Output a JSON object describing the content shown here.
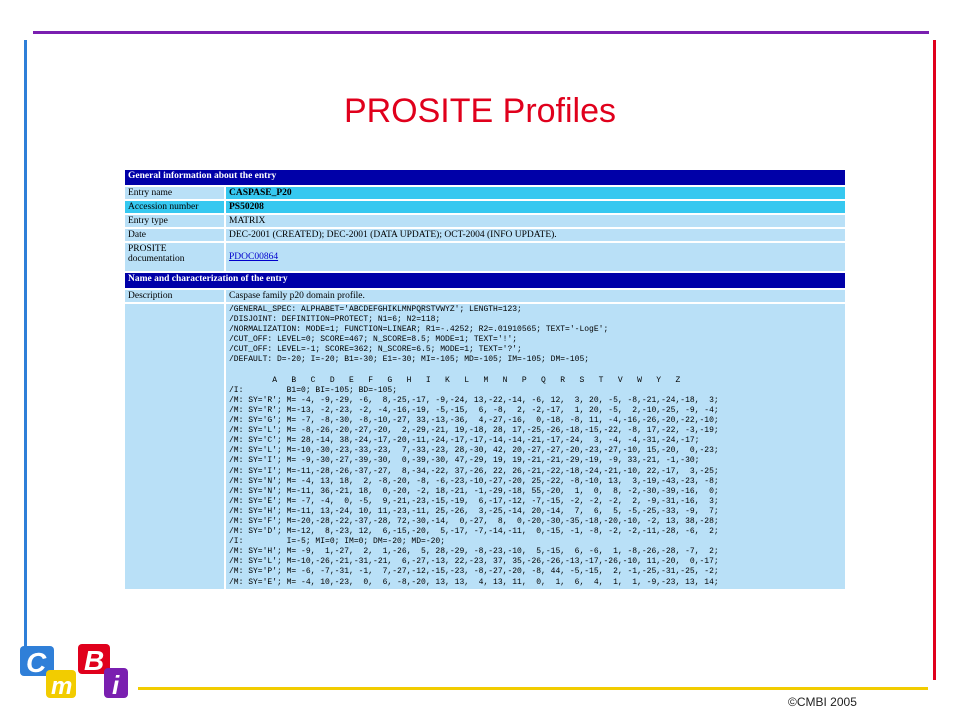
{
  "slide": {
    "title": "PROSITE Profiles",
    "copyright": "©CMBI 2005"
  },
  "logo": {
    "letters": [
      "C",
      "m",
      "B",
      "i"
    ],
    "text": "CMBI"
  },
  "entry": {
    "section_general": "General information about the entry",
    "rows": [
      {
        "label": "Entry name",
        "value": "CASPASE_P20"
      },
      {
        "label": "Accession number",
        "value": "PS50208"
      },
      {
        "label": "Entry type",
        "value": "MATRIX"
      },
      {
        "label": "Date",
        "value": "DEC-2001 (CREATED); DEC-2001 (DATA UPDATE); OCT-2004 (INFO UPDATE)."
      },
      {
        "label": "PROSITE documentation",
        "value": "PDOC00864"
      }
    ],
    "section_name": "Name and characterization of the entry",
    "description_label": "Description",
    "description_value": "Caspase family p20 domain profile.",
    "profile_lines": [
      "/GENERAL_SPEC: ALPHABET='ABCDEFGHIKLMNPQRSTVWYZ'; LENGTH=123;",
      "/DISJOINT: DEFINITION=PROTECT; N1=6; N2=118;",
      "/NORMALIZATION: MODE=1; FUNCTION=LINEAR; R1=-.4252; R2=.01910565; TEXT='-LogE';",
      "/CUT_OFF: LEVEL=0; SCORE=467; N_SCORE=8.5; MODE=1; TEXT='!';",
      "/CUT_OFF: LEVEL=-1; SCORE=362; N_SCORE=6.5; MODE=1; TEXT='?';",
      "/DEFAULT: D=-20; I=-20; B1=-30; E1=-30; MI=-105; MD=-105; IM=-105; DM=-105;",
      "",
      "         A   B   C   D   E   F   G   H   I   K   L   M   N   P   Q   R   S   T   V   W   Y   Z",
      "/I:         B1=0; BI=-105; BD=-105;",
      "/M: SY='R'; M= -4, -9,-29, -6,  8,-25,-17, -9,-24, 13,-22,-14, -6, 12,  3, 20, -5, -8,-21,-24,-18,  3;",
      "/M: SY='R'; M=-13, -2,-23, -2, -4,-16,-19, -5,-15,  6, -8,  2, -2,-17,  1, 20, -5,  2,-10,-25, -9, -4;",
      "/M: SY='G'; M= -7, -8,-30, -8,-10,-27, 33,-13,-36,  4,-27,-16,  0,-18, -8, 11, -4,-16,-26,-20,-22,-10;",
      "/M: SY='L'; M= -8,-26,-20,-27,-20,  2,-29,-21, 19,-18, 28, 17,-25,-26,-18,-15,-22, -8, 17,-22, -3,-19;",
      "/M: SY='C'; M= 28,-14, 38,-24,-17,-20,-11,-24,-17,-17,-14,-14,-21,-17,-24,  3, -4, -4,-31,-24,-17;",
      "/M: SY='L'; M=-10,-30,-23,-33,-23,  7,-33,-23, 28,-30, 42, 20,-27,-27,-20,-23,-27,-10, 15,-20,  0,-23;",
      "/M: SY='I'; M= -9,-30,-27,-39,-30,  0,-39,-30, 47,-29, 19, 19,-21,-21,-29,-19, -9, 33,-21, -1,-30;",
      "/M: SY='I'; M=-11,-28,-26,-37,-27,  8,-34,-22, 37,-26, 22, 26,-21,-22,-18,-24,-21,-10, 22,-17,  3,-25;",
      "/M: SY='N'; M= -4, 13, 18,  2, -8,-20, -8, -6,-23,-10,-27,-20, 25,-22, -8,-10, 13,  3,-19,-43,-23, -8;",
      "/M: SY='N'; M=-11, 36,-21, 18,  0,-20, -2, 18,-21, -1,-29,-18, 55,-20,  1,  0,  8, -2,-30,-39,-16,  0;",
      "/M: SY='E'; M= -7, -4,  0, -5,  9,-21,-23,-15,-19,  6,-17,-12, -7,-15, -2, -2, -2,  2, -9,-31,-16,  3;",
      "/M: SY='H'; M=-11, 13,-24, 10, 11,-23,-11, 25,-26,  3,-25,-14, 20,-14,  7,  6,  5, -5,-25,-33, -9,  7;",
      "/M: SY='F'; M=-20,-28,-22,-37,-28, 72,-30,-14,  0,-27,  8,  0,-20,-30,-35,-18,-20,-10, -2, 13, 38,-28;",
      "/M: SY='D'; M=-12,  8,-23, 12,  6,-15,-20,  5,-17, -7,-14,-11,  0,-15, -1, -8, -2, -2,-11,-28, -6,  2;",
      "/I:         I=-5; MI=0; IM=0; DM=-20; MD=-20;",
      "/M: SY='H'; M= -9,  1,-27,  2,  1,-26,  5, 28,-29, -8,-23,-10,  5,-15,  6, -6,  1, -8,-26,-28, -7,  2;",
      "/M: SY='L'; M=-10,-26,-21,-31,-21,  6,-27,-13, 22,-23, 37, 35,-26,-26,-13,-17,-26,-10, 11,-20,  0,-17;",
      "/M: SY='P'; M= -6, -7,-31, -1,  7,-27,-12,-15,-23, -8,-27,-20, -8, 44, -5,-15,  2, -1,-25,-31,-25, -2;",
      "/M: SY='E'; M= -4, 10,-23,  0,  6, -8,-20, 13, 13,  4, 13, 11,  0,  1,  6,  4,  1,  1, -9,-23, 13, 14;"
    ]
  },
  "colors": {
    "title": "#e0001c",
    "top_rule": "#7a1fb0",
    "left_rule": "#2f7fd8",
    "right_rule": "#e0001c",
    "bottom_rule": "#f2cc00",
    "section_header": "#0000a8",
    "row_light": "#b9e0f7",
    "row_highlight": "#36c8f0",
    "logo_blue": "#2f7fd8",
    "logo_yellow": "#f2cc00",
    "logo_red": "#e0001c",
    "logo_purple": "#7a1fb0"
  }
}
